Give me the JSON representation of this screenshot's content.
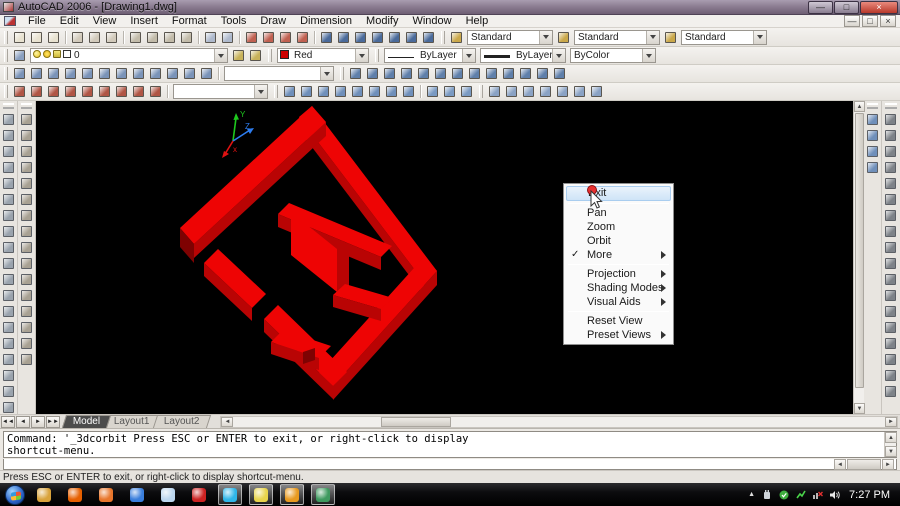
{
  "window": {
    "title": "AutoCAD 2006 - [Drawing1.dwg]"
  },
  "menu_bar": {
    "items": [
      "File",
      "Edit",
      "View",
      "Insert",
      "Format",
      "Tools",
      "Draw",
      "Dimension",
      "Modify",
      "Window",
      "Help"
    ]
  },
  "toolbars": {
    "standard": {
      "groups": [
        {
          "tint": "#e8e2d0",
          "icons": [
            "qnew",
            "open",
            "save"
          ]
        },
        {
          "tint": "#d2cabb",
          "icons": [
            "plot",
            "plot-preview",
            "publish"
          ]
        },
        {
          "tint": "#c2bba9",
          "icons": [
            "cut",
            "copy",
            "paste",
            "match-properties"
          ]
        },
        {
          "tint": "#aeb9cc",
          "icons": [
            "undo",
            "redo"
          ]
        },
        {
          "tint": "#c06050",
          "icons": [
            "pan-realtime",
            "zoom-realtime",
            "zoom-window",
            "zoom-previous"
          ]
        },
        {
          "tint": "#4a6a9a",
          "icons": [
            "properties",
            "designcenter",
            "tool-palettes",
            "sheet-set-manager",
            "markup-set-manager",
            "quick-calc",
            "help"
          ]
        }
      ]
    },
    "styles": {
      "dropdowns": [
        {
          "name": "text-style",
          "value": "Standard"
        },
        {
          "name": "dim-style",
          "value": "Standard"
        },
        {
          "name": "table-style",
          "value": "Standard"
        }
      ]
    },
    "layers": {
      "current_layer": "0",
      "state_icons": [
        "layer-on-bulb",
        "layer-freeze-sun",
        "layer-lock",
        "layer-color-swatch"
      ],
      "post_icons": [
        "make-objects-layer-current",
        "layer-previous"
      ]
    },
    "properties": {
      "color_value": "Red",
      "color_hex": "#cc0000",
      "linetype_value": "ByLayer",
      "lineweight_value": "ByLayer",
      "plot_style_value": "ByColor"
    },
    "view_row": {
      "dropdown_value": "",
      "groups": [
        {
          "tint": "#7a93b8",
          "icons": [
            "named-views",
            "top-view",
            "bottom-view",
            "left-view",
            "right-view",
            "front-view",
            "back-view",
            "sw-isometric",
            "se-isometric",
            "ne-isometric",
            "nw-isometric",
            "camera"
          ]
        },
        {
          "tint": "#5f7faa",
          "icons": [
            "ucs",
            "ucs-world",
            "ucs-previous",
            "ucs-face",
            "ucs-object",
            "ucs-view",
            "ucs-origin",
            "ucs-z-axis-vector",
            "ucs-3point",
            "ucs-x",
            "ucs-y",
            "ucs-z",
            "ucs-apply"
          ]
        }
      ]
    },
    "orbit_row": {
      "dropdown_value": "",
      "groups": [
        {
          "tint": "#b05545",
          "icons": [
            "3d-pan",
            "3d-zoom",
            "3d-orbit",
            "3d-continuous-orbit",
            "3d-swivel",
            "3d-adjust-distance",
            "3d-adjust-clip-planes",
            "front-clip-toggle",
            "back-clip-toggle"
          ]
        },
        {
          "tint": "#6f8fba",
          "icons": [
            "box",
            "sphere",
            "cylinder",
            "cone",
            "wedge",
            "torus",
            "extrude",
            "revolve"
          ]
        },
        {
          "tint": "#7a9ac2",
          "icons": [
            "slice",
            "section",
            "interference"
          ]
        },
        {
          "tint": "#8aa2c4",
          "icons": [
            "2d-wireframe",
            "3d-wireframe",
            "hidden",
            "flat-shaded",
            "gouraud-shaded",
            "flat-shaded-edges-on",
            "gouraud-shaded-edges-on"
          ]
        }
      ]
    }
  },
  "left_dock": {
    "draw_tools": [
      "line",
      "construction-line",
      "polyline",
      "polygon",
      "rectangle",
      "arc",
      "circle",
      "revision-cloud",
      "spline",
      "ellipse",
      "ellipse-arc",
      "insert-block",
      "make-block",
      "point",
      "hatch",
      "gradient",
      "region",
      "table",
      "multiline-text"
    ],
    "modify_tools": [
      "erase",
      "copy-object",
      "mirror",
      "offset",
      "array",
      "move",
      "rotate",
      "scale",
      "stretch",
      "trim",
      "extend",
      "break-at-point",
      "break",
      "chamfer",
      "fillet",
      "explode"
    ]
  },
  "right_dock": {
    "draw_order_tools": [
      "bring-to-front",
      "send-to-back",
      "bring-above-objects",
      "send-under-objects"
    ],
    "dimension_tools": [
      "linear-dimension",
      "aligned-dimension",
      "arc-length-dimension",
      "ordinate-dimension",
      "radius-dimension",
      "jogged-dimension",
      "diameter-dimension",
      "angular-dimension",
      "quick-dimension",
      "baseline-dimension",
      "continue-dimension",
      "quick-leader",
      "tolerance",
      "center-mark",
      "dimension-edit",
      "dimension-text-edit",
      "dimension-update",
      "dimension-style"
    ]
  },
  "canvas": {
    "background": "#000000",
    "model_color_bright": "#ee0404",
    "model_color_mid": "#b90404",
    "model_color_dark": "#7e0202",
    "ucs": {
      "y_label": "Y",
      "z_label": "Z",
      "x_label": "x"
    }
  },
  "context_menu": {
    "items": [
      {
        "label": "Exit",
        "highlighted": true
      },
      {
        "separator": true
      },
      {
        "label": "Pan"
      },
      {
        "label": "Zoom"
      },
      {
        "label": "Orbit"
      },
      {
        "label": "More",
        "checked": true,
        "submenu": true
      },
      {
        "separator": true
      },
      {
        "label": "Projection",
        "submenu": true
      },
      {
        "label": "Shading Modes",
        "submenu": true
      },
      {
        "label": "Visual Aids",
        "submenu": true
      },
      {
        "separator": true
      },
      {
        "label": "Reset View"
      },
      {
        "label": "Preset Views",
        "submenu": true
      }
    ]
  },
  "layout_tabs": {
    "tabs": [
      {
        "label": "Model",
        "active": true
      },
      {
        "label": "Layout1",
        "active": false
      },
      {
        "label": "Layout2",
        "active": false
      }
    ]
  },
  "command_line": {
    "history_line1": "Command: '_3dcorbit Press ESC or ENTER to exit, or right-click to display",
    "history_line2": "shortcut-menu.",
    "input_value": ""
  },
  "status_bar": {
    "message": "Press ESC or ENTER to exit, or right-click to display shortcut-menu."
  },
  "taskbar": {
    "buttons": [
      {
        "name": "windows-explorer",
        "color": "#d9a33c",
        "running": false
      },
      {
        "name": "firefox",
        "color": "#e66000",
        "running": false
      },
      {
        "name": "media-player",
        "color": "#e8762c",
        "running": false
      },
      {
        "name": "browser",
        "color": "#3a7edc",
        "running": false
      },
      {
        "name": "notes-editor",
        "color": "#bcd6ee",
        "running": false
      },
      {
        "name": "installer",
        "color": "#cc2222",
        "running": false
      },
      {
        "name": "skype",
        "color": "#2fb6e8",
        "running": true
      },
      {
        "name": "sticky-notes",
        "color": "#e8d44c",
        "running": true
      },
      {
        "name": "utility",
        "color": "#e89a20",
        "running": true
      },
      {
        "name": "autocad-taskbar",
        "color": "#3f9a5f",
        "running": true
      }
    ],
    "clock": "7:27 PM"
  }
}
